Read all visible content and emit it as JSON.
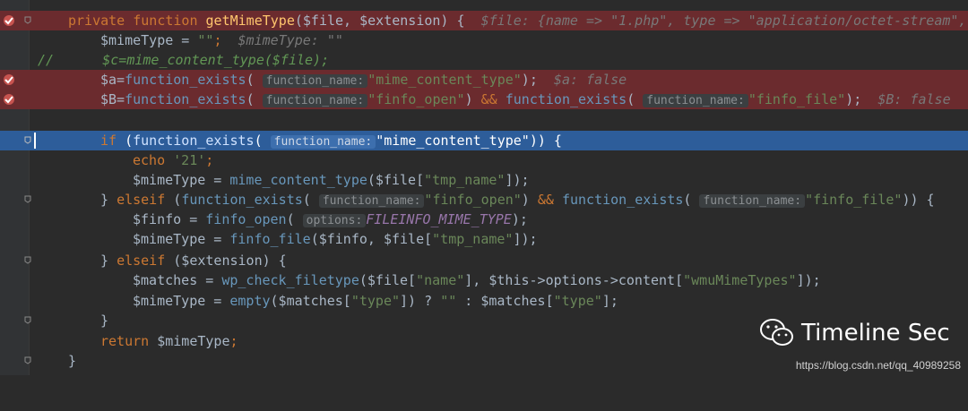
{
  "watermark": {
    "brand": "Timeline Sec",
    "url": "https://blog.csdn.net/qq_40989258"
  },
  "hints": {
    "function_name": "function_name:",
    "options": "options:"
  },
  "inline": {
    "sig": "$file: {name => \"1.php\", type => \"application/octet-stream\",",
    "mime": "$mimeType: \"\"",
    "a": "$a: false",
    "b": "$B: false"
  },
  "colors": {
    "editor_bg": "#2b2b2b",
    "breakpoint_bg": "#6b2b2e",
    "current_line_bg": "#2d5d9a",
    "keyword": "#cc7832",
    "function_name": "#ffc66d",
    "string": "#6a8759",
    "comment": "#629755"
  }
}
